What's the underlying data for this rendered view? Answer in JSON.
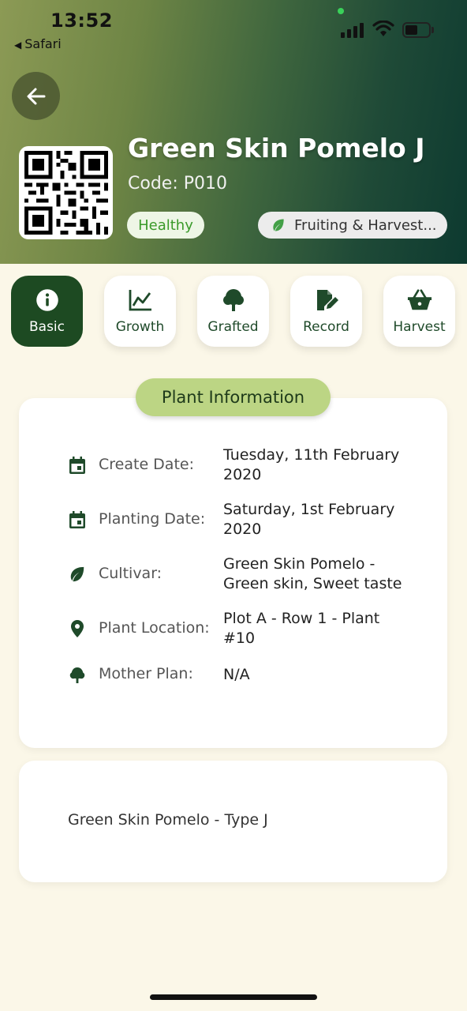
{
  "status_bar": {
    "time": "13:52",
    "back_app": "Safari"
  },
  "plant": {
    "name": "Green Skin Pomelo J",
    "code": "Code: P010",
    "health": "Healthy",
    "stage": "Fruiting & Harvest..."
  },
  "tabs": [
    {
      "label": "Basic",
      "icon": "info-icon",
      "active": true
    },
    {
      "label": "Growth",
      "icon": "chart-line-icon",
      "active": false
    },
    {
      "label": "Grafted",
      "icon": "tree-icon",
      "active": false
    },
    {
      "label": "Record",
      "icon": "edit-note-icon",
      "active": false
    },
    {
      "label": "Harvest",
      "icon": "basket-icon",
      "active": false
    }
  ],
  "info": {
    "section_title": "Plant Information",
    "rows": [
      {
        "label": "Create Date:",
        "value": "Tuesday, 11th February 2020",
        "icon": "calendar-icon"
      },
      {
        "label": "Planting Date:",
        "value": "Saturday, 1st February 2020",
        "icon": "calendar-icon"
      },
      {
        "label": "Cultivar:",
        "value": "Green Skin Pomelo - Green skin, Sweet taste",
        "icon": "leaf-icon"
      },
      {
        "label": "Plant Location:",
        "value": "Plot A - Row 1 - Plant #10",
        "icon": "location-pin-icon"
      },
      {
        "label": "Mother Plan:",
        "value": "N/A",
        "icon": "tree-icon"
      }
    ]
  },
  "description": "Green Skin Pomelo - Type J",
  "colors": {
    "brand_dark": "#1d4a22",
    "accent_pill": "#bcd584",
    "healthy_text": "#3a9a2a",
    "background": "#fbf7e8"
  }
}
